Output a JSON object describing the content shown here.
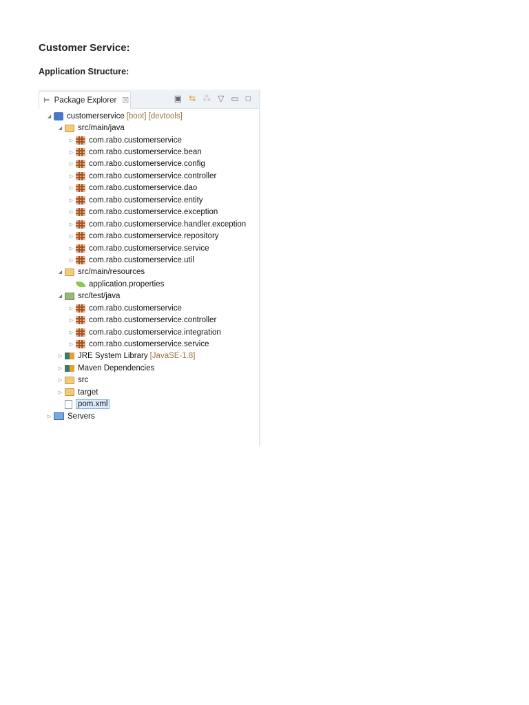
{
  "heading": "Customer Service:",
  "subheading": "Application Structure:",
  "panel": {
    "tab_label": "Package Explorer",
    "close": "☒"
  },
  "tree": [
    {
      "level": 0,
      "arrow": "◢",
      "icon": "project",
      "label": "customerservice",
      "decoration": "[boot] [devtools]"
    },
    {
      "level": 1,
      "arrow": "◢",
      "icon": "srcfolder",
      "label": "src/main/java"
    },
    {
      "level": 2,
      "arrow": "▷",
      "icon": "pkg",
      "label": "com.rabo.customerservice"
    },
    {
      "level": 2,
      "arrow": "▷",
      "icon": "pkg",
      "label": "com.rabo.customerservice.bean"
    },
    {
      "level": 2,
      "arrow": "▷",
      "icon": "pkg",
      "label": "com.rabo.customerservice.config"
    },
    {
      "level": 2,
      "arrow": "▷",
      "icon": "pkg",
      "label": "com.rabo.customerservice.controller"
    },
    {
      "level": 2,
      "arrow": "▷",
      "icon": "pkg",
      "label": "com.rabo.customerservice.dao"
    },
    {
      "level": 2,
      "arrow": "▷",
      "icon": "pkg",
      "label": "com.rabo.customerservice.entity"
    },
    {
      "level": 2,
      "arrow": "▷",
      "icon": "pkg",
      "label": "com.rabo.customerservice.exception"
    },
    {
      "level": 2,
      "arrow": "▷",
      "icon": "pkg",
      "label": "com.rabo.customerservice.handler.exception"
    },
    {
      "level": 2,
      "arrow": "▷",
      "icon": "pkg",
      "label": "com.rabo.customerservice.repository"
    },
    {
      "level": 2,
      "arrow": "▷",
      "icon": "pkg",
      "label": "com.rabo.customerservice.service"
    },
    {
      "level": 2,
      "arrow": "▷",
      "icon": "pkg",
      "label": "com.rabo.customerservice.util"
    },
    {
      "level": 1,
      "arrow": "◢",
      "icon": "srcfolder",
      "label": "src/main/resources"
    },
    {
      "level": 2,
      "arrow": "",
      "icon": "leaf",
      "label": "application.properties"
    },
    {
      "level": 1,
      "arrow": "◢",
      "icon": "testfolder",
      "label": "src/test/java"
    },
    {
      "level": 2,
      "arrow": "▷",
      "icon": "pkg",
      "label": "com.rabo.customerservice"
    },
    {
      "level": 2,
      "arrow": "▷",
      "icon": "pkg",
      "label": "com.rabo.customerservice.controller"
    },
    {
      "level": 2,
      "arrow": "▷",
      "icon": "pkg",
      "label": "com.rabo.customerservice.integration"
    },
    {
      "level": 2,
      "arrow": "▷",
      "icon": "pkg",
      "label": "com.rabo.customerservice.service"
    },
    {
      "level": 1,
      "arrow": "▷",
      "icon": "lib",
      "label": "JRE System Library",
      "decoration": "[JavaSE-1.8]"
    },
    {
      "level": 1,
      "arrow": "▷",
      "icon": "lib",
      "label": "Maven Dependencies"
    },
    {
      "level": 1,
      "arrow": "▷",
      "icon": "folder",
      "label": "src"
    },
    {
      "level": 1,
      "arrow": "▷",
      "icon": "folder",
      "label": "target"
    },
    {
      "level": 1,
      "arrow": "",
      "icon": "file",
      "label": "pom.xml",
      "selected": true
    },
    {
      "level": 0,
      "arrow": "▷",
      "icon": "servers",
      "label": "Servers"
    }
  ]
}
